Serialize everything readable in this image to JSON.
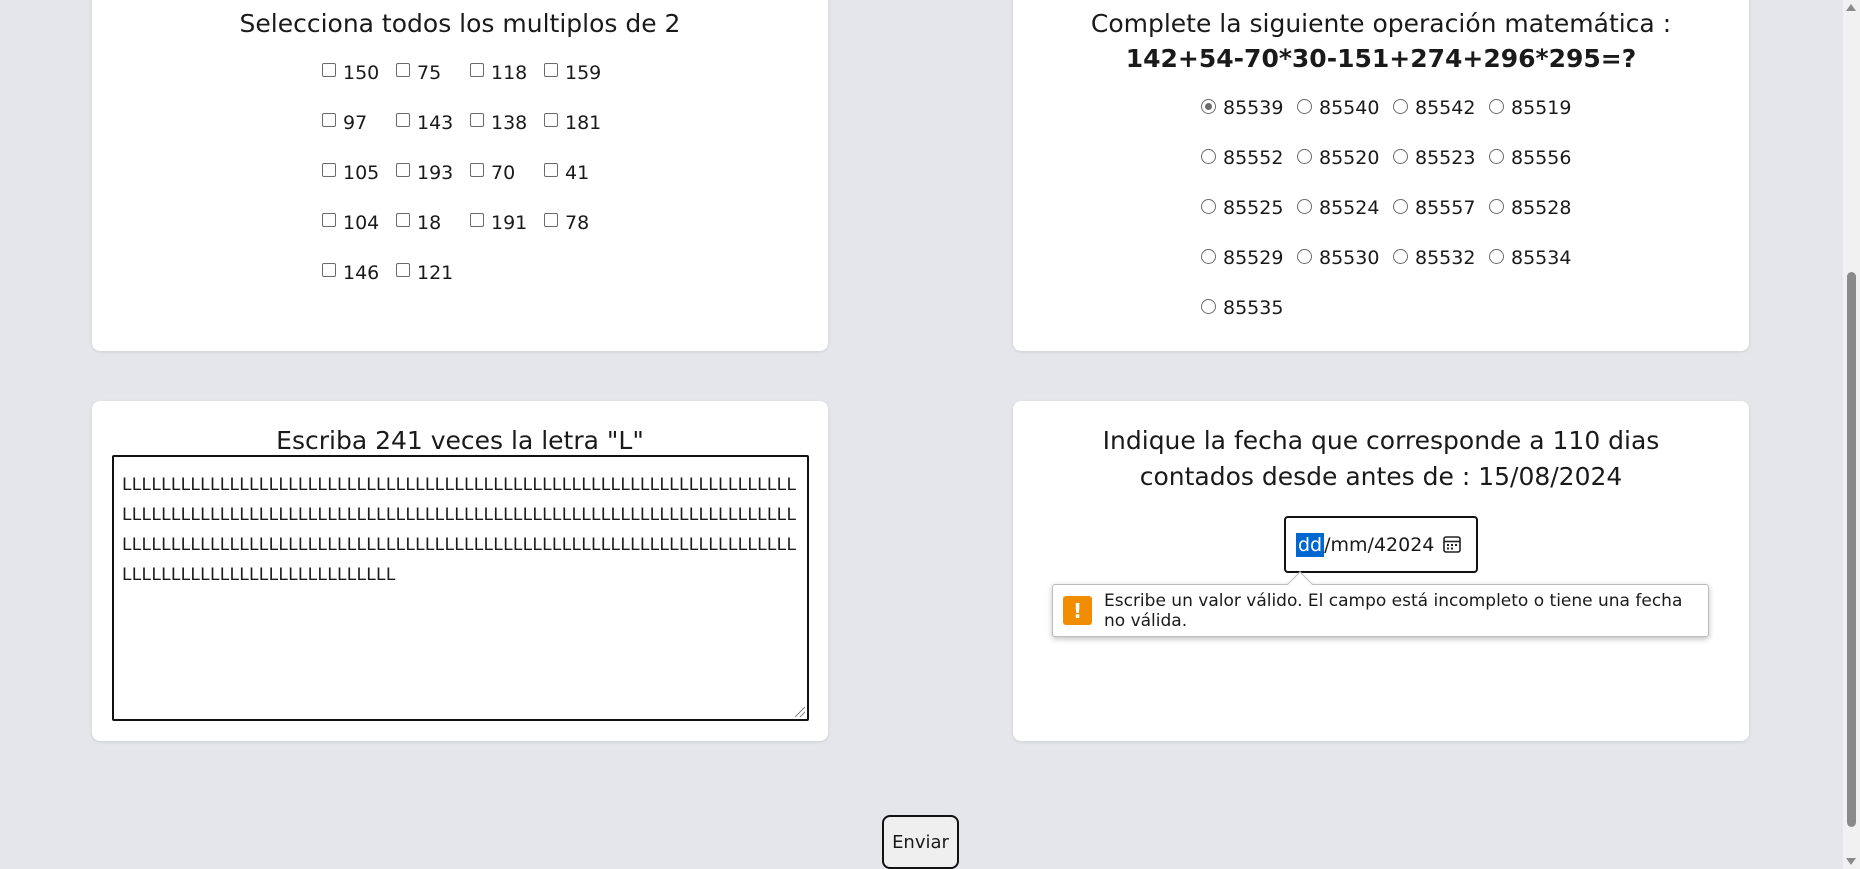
{
  "question1": {
    "title": "Selecciona todos los multiplos de 2",
    "options": [
      "150",
      "75",
      "118",
      "159",
      "97",
      "143",
      "138",
      "181",
      "105",
      "193",
      "70",
      "41",
      "104",
      "18",
      "191",
      "78",
      "146",
      "121"
    ]
  },
  "question2": {
    "title": "Complete la siguiente operación matemática :",
    "expression": "142+54-70*30-151+274+296*295=?",
    "selected": "85539",
    "options": [
      "85539",
      "85540",
      "85542",
      "85519",
      "85552",
      "85520",
      "85523",
      "85556",
      "85525",
      "85524",
      "85557",
      "85528",
      "85529",
      "85530",
      "85532",
      "85534",
      "85535"
    ]
  },
  "question3": {
    "title": "Escriba 241 veces la letra \"L\"",
    "value": "LLLLLLLLLLLLLLLLLLLLLLLLLLLLLLLLLLLLLLLLLLLLLLLLLLLLLLLLLLLLLLLLLLLLLLLLLLLLLLLLLLLLLLLLLLLLLLLLLLLLLLLLLLLLLLLLLLLLLLLLLLLLLLLLLLLLLLLLLLLLLLLLLLLLLLLLLLLLLLLLLLLLLLLLLLLLLLLLLLLLLLLLLLLLLLLLLLLLLLLLLLLLLLLLLLLLLLLLLLLLLLLLLLLLLLLLLLL"
  },
  "question4": {
    "title": "Indique la fecha que corresponde a 110 dias contados desde antes de : 15/08/2024",
    "date_day": "dd",
    "date_rest": "/mm/42024",
    "validation_message": "Escribe un valor válido. El campo está incompleto o tiene una fecha no válida."
  },
  "submit_label": "Enviar",
  "icons": {
    "date_picker": "calendar-icon",
    "validation": "warning-icon"
  },
  "colors": {
    "accent": "#0067d1",
    "warning": "#f28c00",
    "background": "#e5e6ea"
  }
}
